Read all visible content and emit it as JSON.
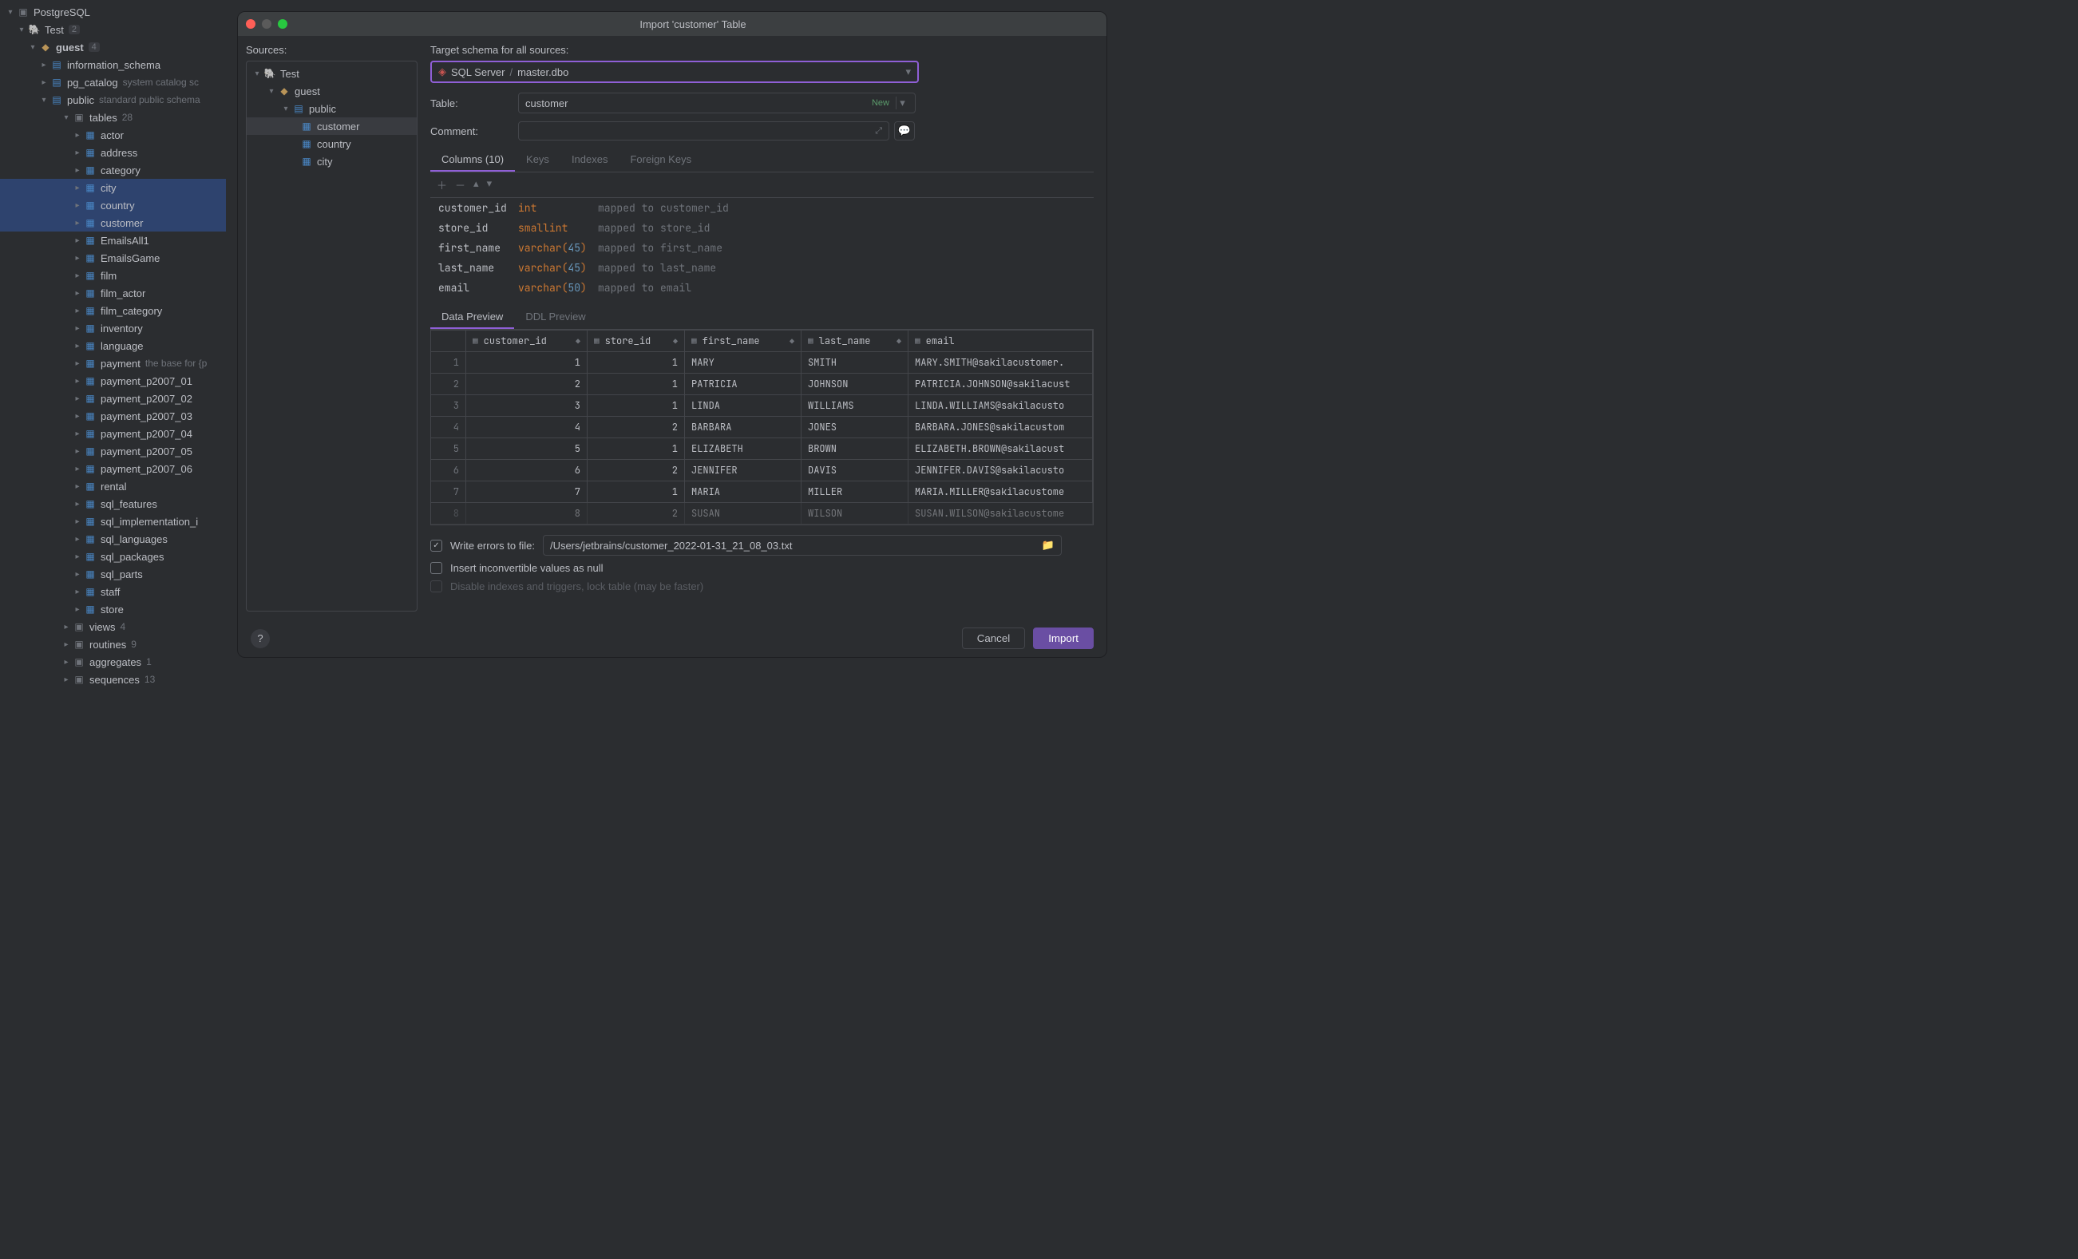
{
  "tree": {
    "root": "PostgreSQL",
    "connection": "Test",
    "connection_badge": "2",
    "db": "guest",
    "db_badge": "4",
    "schemas": [
      {
        "name": "information_schema",
        "hint": ""
      },
      {
        "name": "pg_catalog",
        "hint": "system catalog sc"
      },
      {
        "name": "public",
        "hint": "standard public schema",
        "expanded": true
      }
    ],
    "tables_label": "tables",
    "tables_count": "28",
    "tables": [
      "actor",
      "address",
      "category",
      "city",
      "country",
      "customer",
      "EmailsAll1",
      "EmailsGame",
      "film",
      "film_actor",
      "film_category",
      "inventory",
      "language",
      "payment",
      "payment_p2007_01",
      "payment_p2007_02",
      "payment_p2007_03",
      "payment_p2007_04",
      "payment_p2007_05",
      "payment_p2007_06",
      "rental",
      "sql_features",
      "sql_implementation_i",
      "sql_languages",
      "sql_packages",
      "sql_parts",
      "staff",
      "store"
    ],
    "payment_hint": "the base for {p",
    "views": {
      "label": "views",
      "badge": "4"
    },
    "routines": {
      "label": "routines",
      "badge": "9"
    },
    "aggregates": {
      "label": "aggregates",
      "badge": "1"
    },
    "sequences": {
      "label": "sequences",
      "badge": "13"
    }
  },
  "dialog": {
    "title": "Import 'customer' Table",
    "sources_label": "Sources:",
    "target_label": "Target schema for all sources:",
    "target_server": "SQL Server",
    "target_schema": "master.dbo",
    "table_label": "Table:",
    "table_value": "customer",
    "table_new": "New",
    "comment_label": "Comment:",
    "src_tree": {
      "conn": "Test",
      "db": "guest",
      "schema": "public",
      "tables": [
        "customer",
        "country",
        "city"
      ]
    },
    "tabs": {
      "columns": "Columns (10)",
      "keys": "Keys",
      "indexes": "Indexes",
      "fkeys": "Foreign Keys"
    },
    "mappings": [
      {
        "name": "customer_id",
        "type": "int",
        "target": "mapped to customer_id"
      },
      {
        "name": "store_id",
        "type": "smallint",
        "target": "mapped to store_id"
      },
      {
        "name": "first_name",
        "type": "varchar",
        "size": "45",
        "target": "mapped to first_name"
      },
      {
        "name": "last_name",
        "type": "varchar",
        "size": "45",
        "target": "mapped to last_name"
      },
      {
        "name": "email",
        "type": "varchar",
        "size": "50",
        "target": "mapped to email"
      }
    ],
    "preview_tabs": {
      "data": "Data Preview",
      "ddl": "DDL Preview"
    },
    "columns": [
      "customer_id",
      "store_id",
      "first_name",
      "last_name",
      "email"
    ],
    "rows": [
      {
        "n": "1",
        "cid": "1",
        "sid": "1",
        "fn": "MARY",
        "ln": "SMITH",
        "em": "MARY.SMITH@sakilacustomer."
      },
      {
        "n": "2",
        "cid": "2",
        "sid": "1",
        "fn": "PATRICIA",
        "ln": "JOHNSON",
        "em": "PATRICIA.JOHNSON@sakilacust"
      },
      {
        "n": "3",
        "cid": "3",
        "sid": "1",
        "fn": "LINDA",
        "ln": "WILLIAMS",
        "em": "LINDA.WILLIAMS@sakilacusto"
      },
      {
        "n": "4",
        "cid": "4",
        "sid": "2",
        "fn": "BARBARA",
        "ln": "JONES",
        "em": "BARBARA.JONES@sakilacustom"
      },
      {
        "n": "5",
        "cid": "5",
        "sid": "1",
        "fn": "ELIZABETH",
        "ln": "BROWN",
        "em": "ELIZABETH.BROWN@sakilacust"
      },
      {
        "n": "6",
        "cid": "6",
        "sid": "2",
        "fn": "JENNIFER",
        "ln": "DAVIS",
        "em": "JENNIFER.DAVIS@sakilacusto"
      },
      {
        "n": "7",
        "cid": "7",
        "sid": "1",
        "fn": "MARIA",
        "ln": "MILLER",
        "em": "MARIA.MILLER@sakilacustome"
      },
      {
        "n": "8",
        "cid": "8",
        "sid": "2",
        "fn": "SUSAN",
        "ln": "WILSON",
        "em": "SUSAN.WILSON@sakilacustome"
      }
    ],
    "write_errors_label": "Write errors to file:",
    "write_errors_path": "/Users/jetbrains/customer_2022-01-31_21_08_03.txt",
    "insert_null_label": "Insert inconvertible values as null",
    "disable_idx_label": "Disable indexes and triggers, lock table (may be faster)",
    "cancel": "Cancel",
    "import": "Import"
  }
}
